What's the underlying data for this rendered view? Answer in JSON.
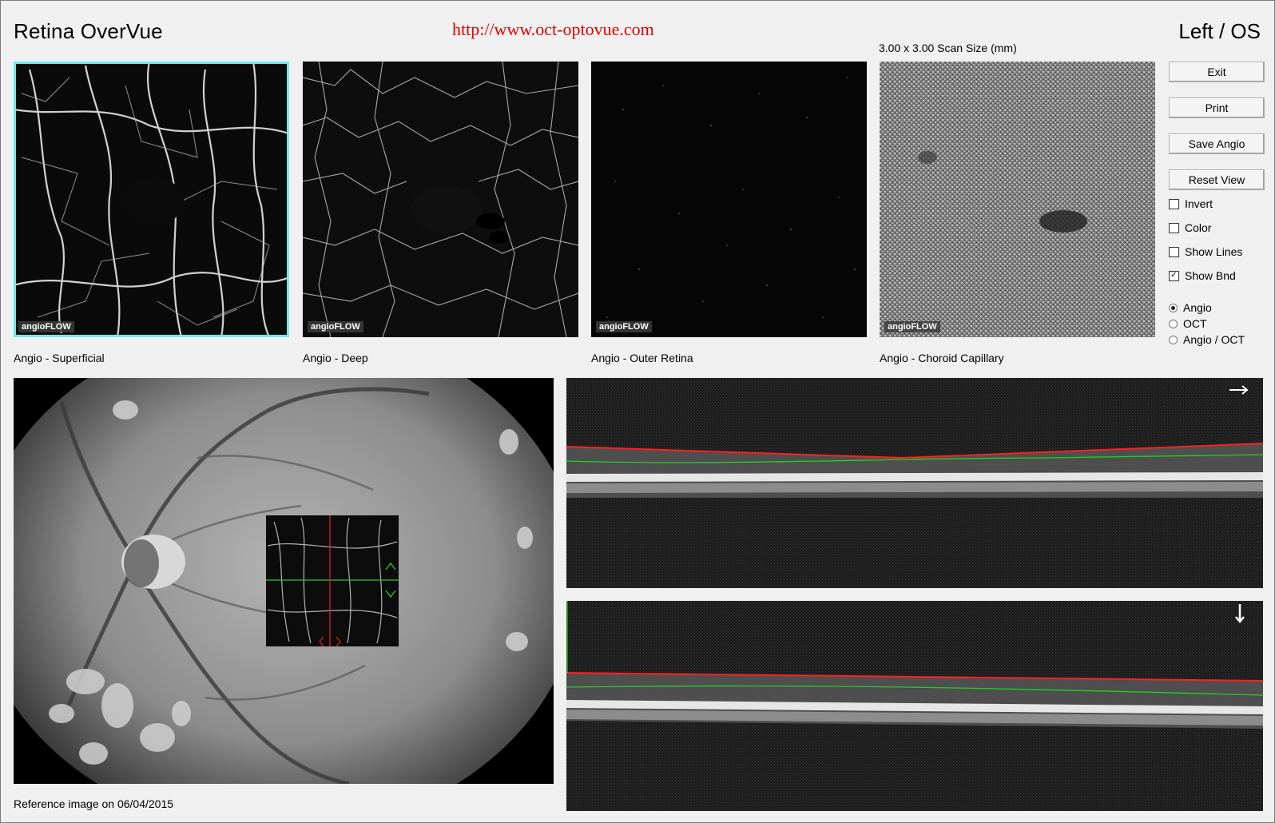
{
  "header": {
    "app_title": "Retina OverVue",
    "watermark": "http://www.oct-optovue.com",
    "eye": "Left / OS",
    "scan_size": "3.00 x 3.00 Scan Size (mm)"
  },
  "thumbnails": [
    {
      "caption": "Angio - Superficial",
      "logo": "angioFLOW",
      "selected": true
    },
    {
      "caption": "Angio - Deep",
      "logo": "angioFLOW",
      "selected": false
    },
    {
      "caption": "Angio - Outer Retina",
      "logo": "angioFLOW",
      "selected": false
    },
    {
      "caption": "Angio - Choroid Capillary",
      "logo": "angioFLOW",
      "selected": false
    }
  ],
  "buttons": {
    "exit": "Exit",
    "print": "Print",
    "save_angio": "Save Angio",
    "reset_view": "Reset View"
  },
  "options": {
    "invert": {
      "label": "Invert",
      "checked": false
    },
    "color": {
      "label": "Color",
      "checked": false
    },
    "show_lines": {
      "label": "Show Lines",
      "checked": false
    },
    "show_bnd": {
      "label": "Show Bnd",
      "checked": true
    }
  },
  "view_mode": {
    "selected": "Angio",
    "options": [
      "Angio",
      "OCT",
      "Angio / OCT"
    ]
  },
  "reference": {
    "caption": "Reference image on 06/04/2015"
  },
  "colors": {
    "selection_border": "#6fe9ee",
    "watermark": "#e00000",
    "boundary_top": "#ff2020",
    "boundary_lower": "#20d020"
  },
  "icons": {
    "horizontal_scan_arrow": "arrow-right-icon",
    "vertical_scan_arrow": "arrow-down-icon"
  }
}
